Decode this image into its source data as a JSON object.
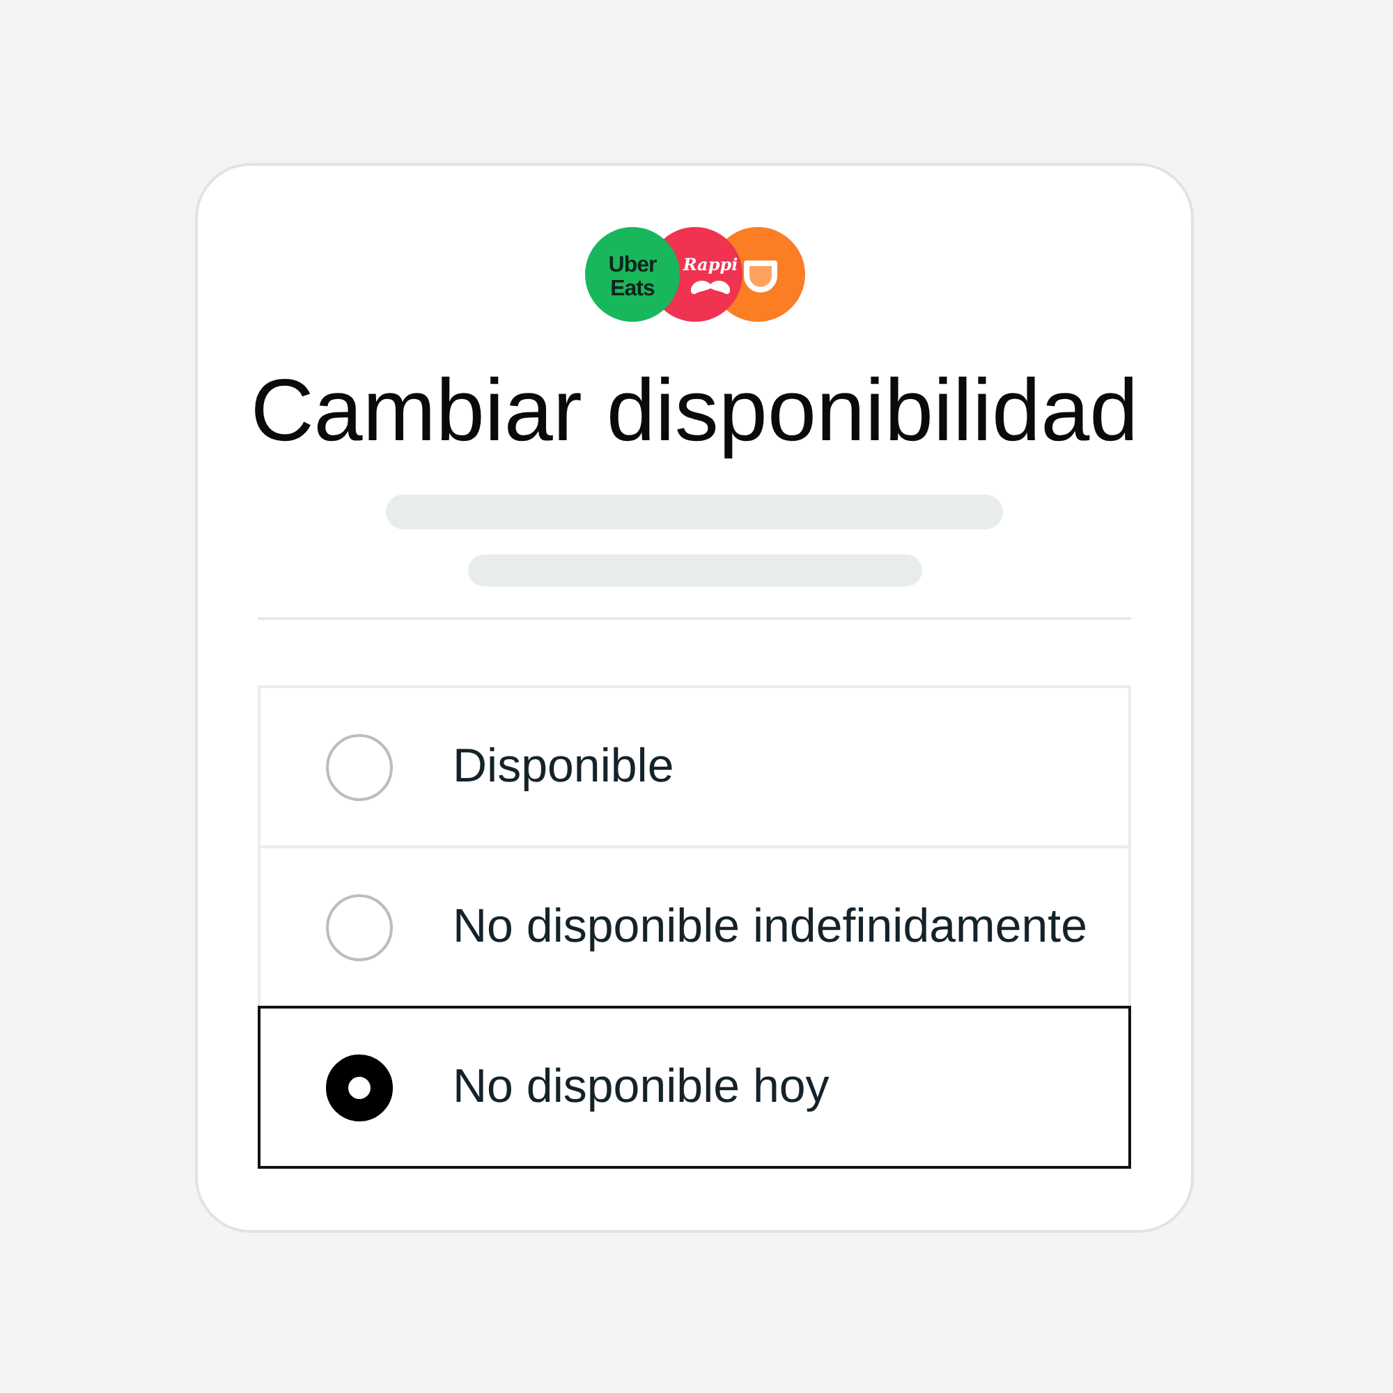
{
  "logos": [
    {
      "kind": "uber_eats",
      "color": "#19b75b",
      "text_lines": [
        "Uber",
        "Eats"
      ]
    },
    {
      "kind": "rappi",
      "color": "#ef3350",
      "label": "Rappi"
    },
    {
      "kind": "didi",
      "color": "#fb7d24"
    }
  ],
  "title": "Cambiar disponibilidad",
  "skeleton_lines": [
    {
      "kind": "long"
    },
    {
      "kind": "short"
    }
  ],
  "options": [
    {
      "label": "Disponible",
      "selected": false
    },
    {
      "label": "No disponible indefinidamente",
      "selected": false
    },
    {
      "label": "No disponible hoy",
      "selected": true
    }
  ]
}
